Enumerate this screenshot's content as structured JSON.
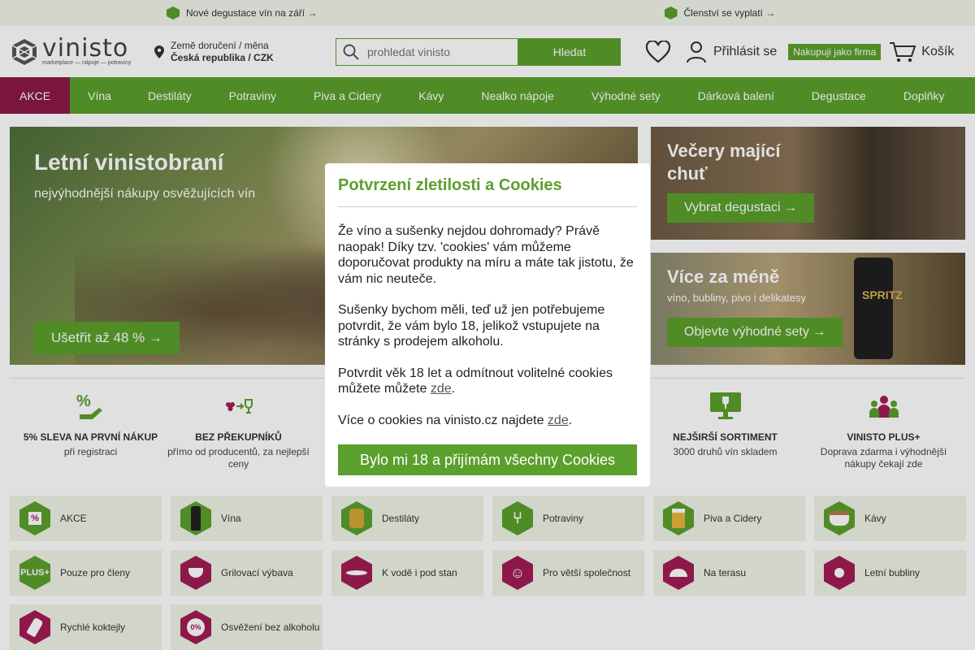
{
  "topbar": {
    "promo_left": "Nové degustace vín na září →",
    "promo_right": "Členství se vyplatí →"
  },
  "header": {
    "logo": "vinisto",
    "logo_sub": "marketplace — nápoje — potraviny",
    "delivery_label": "Země doručení / měna",
    "delivery_value": "Česká republika / CZK",
    "search_placeholder": "prohledat vinisto",
    "search_button": "Hledat",
    "login": "Přihlásit se",
    "firm_button": "Nakupuji jako firma",
    "cart": "Košík"
  },
  "nav": {
    "items": [
      "AKCE",
      "Vína",
      "Destiláty",
      "Potraviny",
      "Piva a Cidery",
      "Kávy",
      "Nealko nápoje",
      "Výhodné sety",
      "Dárková balení",
      "Degustace",
      "Doplňky"
    ]
  },
  "hero": {
    "title": "Letní vinistobraní",
    "subtitle": "nejvýhodnější nákupy osvěžujících vín",
    "button": "Ušetřit až 48 % →"
  },
  "side_cards": [
    {
      "title": "Večery mající chuť",
      "subtitle": "",
      "button": "Vybrat degustaci →"
    },
    {
      "title": "Více za méně",
      "subtitle": "víno, bubliny, pivo i delikatesy",
      "button": "Objevte výhodné sety →",
      "can_text": "SPRITZ"
    }
  ],
  "benefits": [
    {
      "title": "5% SLEVA NA PRVNÍ NÁKUP",
      "text": "při registraci"
    },
    {
      "title": "BEZ PŘEKUPNÍKŮ",
      "text": "přímo od producentů, za nejlepší ceny"
    },
    {
      "title": "NEJŠIRŠÍ SORTIMENT",
      "text": "3000 druhů vín skladem"
    },
    {
      "title": "VINISTO PLUS+",
      "text": "Doprava zdarma i výhodnější nákupy čekají zde"
    }
  ],
  "categories": [
    {
      "label": "AKCE",
      "icon": "percent-tag-icon",
      "color": "green"
    },
    {
      "label": "Vína",
      "icon": "wine-bottle-icon",
      "color": "green"
    },
    {
      "label": "Destiláty",
      "icon": "spirit-bottle-icon",
      "color": "green"
    },
    {
      "label": "Potraviny",
      "icon": "cutlery-icon",
      "color": "green"
    },
    {
      "label": "Piva a Cidery",
      "icon": "beer-glass-icon",
      "color": "green"
    },
    {
      "label": "Kávy",
      "icon": "coffee-cup-icon",
      "color": "green"
    },
    {
      "label": "Pouze pro členy",
      "icon": "plus-badge-icon",
      "color": "green",
      "badge": "PLUS+"
    },
    {
      "label": "Grilovací výbava",
      "icon": "grill-icon",
      "color": "pink"
    },
    {
      "label": "K vodě i pod stan",
      "icon": "kayak-icon",
      "color": "pink"
    },
    {
      "label": "Pro větší společnost",
      "icon": "group-icon",
      "color": "pink"
    },
    {
      "label": "Na terasu",
      "icon": "parasol-table-icon",
      "color": "pink"
    },
    {
      "label": "Letní bubliny",
      "icon": "bubbles-icon",
      "color": "pink"
    },
    {
      "label": "Rychlé koktejly",
      "icon": "shaker-icon",
      "color": "pink"
    },
    {
      "label": "Osvěžení bez alkoholu",
      "icon": "zero-alcohol-drop-icon",
      "color": "pink",
      "badge": "0%"
    }
  ],
  "modal": {
    "title": "Potvrzení zletilosti a Cookies",
    "p1": "Že víno a sušenky nejdou dohromady? Právě naopak! Díky tzv. 'cookies' vám můžeme doporučovat produkty na míru a máte tak jistotu, že vám nic neuteče.",
    "p2": "Sušenky bychom měli, teď už jen potřebujeme potvrdit, že vám bylo 18, jelikož vstupujete na stránky s prodejem alkoholu.",
    "p3_text": "Potvrdit věk 18 let a odmítnout volitelné cookies můžete můžete ",
    "p3_link": "zde",
    "p4_text": "Více o cookies na vinisto.cz najdete ",
    "p4_link": "zde",
    "button": "Bylo mi 18 a přijímám všechny Cookies"
  },
  "colors": {
    "brand_green": "#5aa02c",
    "akce_red": "#8b1a47",
    "category_pink": "#a31c55",
    "category_bg": "#eef3e6"
  }
}
